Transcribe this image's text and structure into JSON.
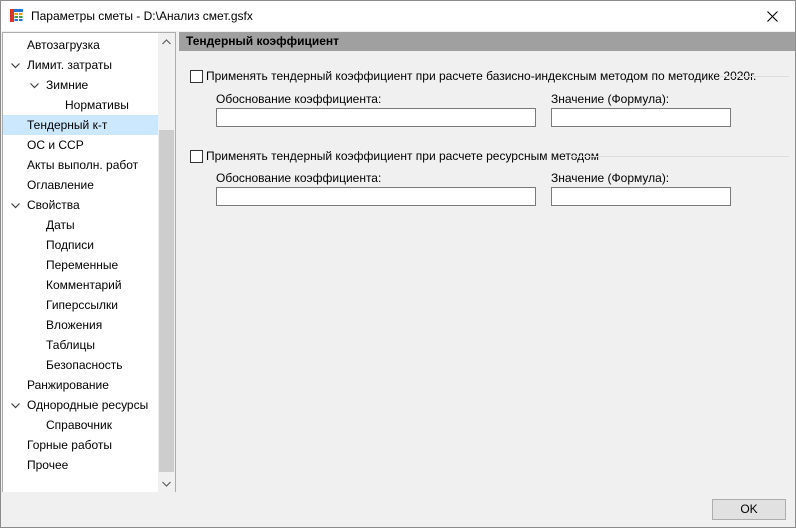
{
  "window": {
    "title": "Параметры сметы - D:\\Анализ смет.gsfx",
    "icon": "table-app-icon",
    "close_icon": "close-icon"
  },
  "tree": {
    "items": [
      {
        "label": "Автозагрузка",
        "level": 0,
        "expandable": false
      },
      {
        "label": "Лимит. затраты",
        "level": 0,
        "expandable": true,
        "expanded": true
      },
      {
        "label": "Зимние",
        "level": 1,
        "expandable": true,
        "expanded": true
      },
      {
        "label": "Нормативы",
        "level": 2,
        "expandable": false
      },
      {
        "label": "Тендерный к-т",
        "level": 0,
        "expandable": false,
        "selected": true
      },
      {
        "label": "ОС и ССР",
        "level": 0,
        "expandable": false
      },
      {
        "label": "Акты выполн. работ",
        "level": 0,
        "expandable": false
      },
      {
        "label": "Оглавление",
        "level": 0,
        "expandable": false
      },
      {
        "label": "Свойства",
        "level": 0,
        "expandable": true,
        "expanded": true
      },
      {
        "label": "Даты",
        "level": 1,
        "expandable": false
      },
      {
        "label": "Подписи",
        "level": 1,
        "expandable": false
      },
      {
        "label": "Переменные",
        "level": 1,
        "expandable": false
      },
      {
        "label": "Комментарий",
        "level": 1,
        "expandable": false
      },
      {
        "label": "Гиперссылки",
        "level": 1,
        "expandable": false
      },
      {
        "label": "Вложения",
        "level": 1,
        "expandable": false
      },
      {
        "label": "Таблицы",
        "level": 1,
        "expandable": false
      },
      {
        "label": "Безопасность",
        "level": 1,
        "expandable": false
      },
      {
        "label": "Ранжирование",
        "level": 0,
        "expandable": false
      },
      {
        "label": "Однородные ресурсы",
        "level": 0,
        "expandable": true,
        "expanded": true
      },
      {
        "label": "Справочник",
        "level": 1,
        "expandable": false
      },
      {
        "label": "Горные работы",
        "level": 0,
        "expandable": false
      },
      {
        "label": "Прочее",
        "level": 0,
        "expandable": false
      }
    ],
    "selected_color": "#cce8ff"
  },
  "content": {
    "section_title": "Тендерный коэффициент",
    "groups": [
      {
        "checkbox_label": "Применять тендерный коэффициент при расчете базисно-индексным методом по методике 2020г.",
        "checked": false,
        "reason_label": "Обоснование коэффициента:",
        "reason_value": "",
        "value_label": "Значение (Формула):",
        "value_value": ""
      },
      {
        "checkbox_label": "Применять тендерный коэффициент при расчете ресурсным методом",
        "checked": false,
        "reason_label": "Обоснование коэффициента:",
        "reason_value": "",
        "value_label": "Значение (Формула):",
        "value_value": ""
      }
    ]
  },
  "footer": {
    "ok_label": "OK"
  }
}
